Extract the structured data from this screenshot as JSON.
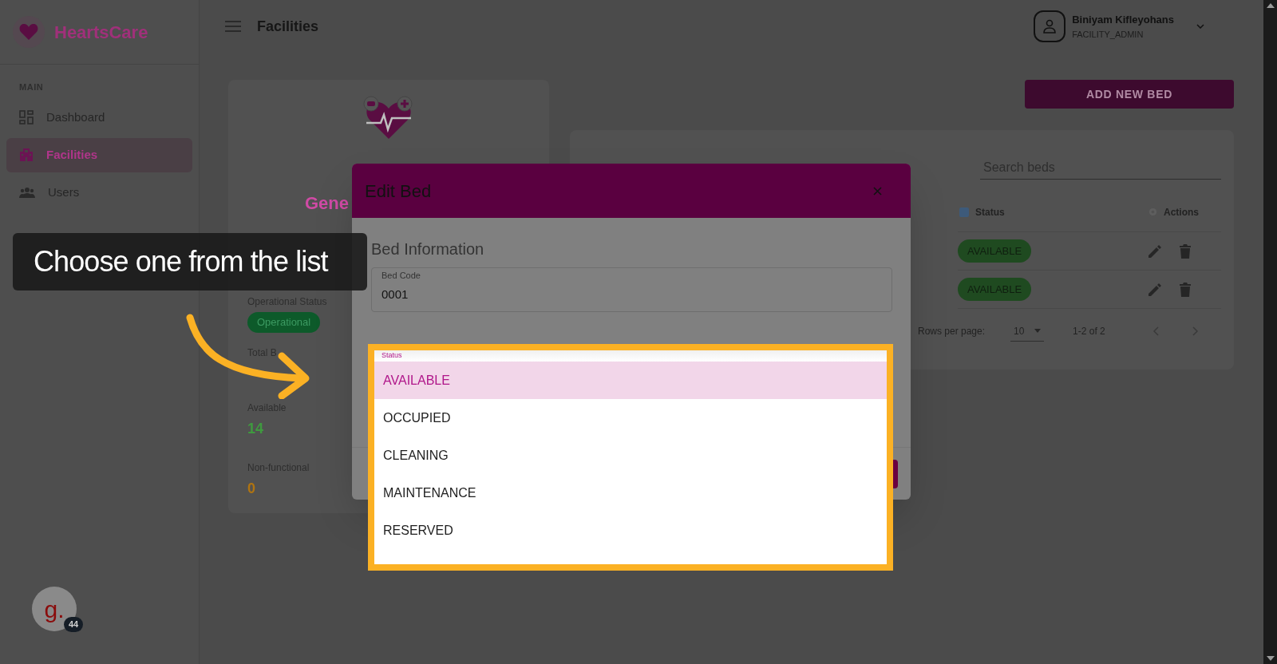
{
  "brand": {
    "name": "HeartsCare"
  },
  "sidebar": {
    "section": "MAIN",
    "items": [
      {
        "label": "Dashboard",
        "kind": "dashboard",
        "selected": false
      },
      {
        "label": "Facilities",
        "kind": "facilities",
        "selected": true
      },
      {
        "label": "Users",
        "kind": "users",
        "selected": false
      }
    ]
  },
  "header": {
    "title": "Facilities",
    "user": {
      "name": "Biniyam Kifleyohans",
      "role": "FACILITY_ADMIN"
    }
  },
  "facility_card": {
    "title": "Gene",
    "operational_status_label": "Operational Status",
    "operational_status": "Operational",
    "stats": [
      {
        "label": "Total B"
      },
      {
        "label": "Available",
        "value": "14",
        "color": "#3f9a3f"
      },
      {
        "label": "Non-functional",
        "value": "0",
        "color": "#b07410"
      }
    ]
  },
  "add_button": "ADD NEW BED",
  "beds_table": {
    "search_placeholder": "Search beds",
    "columns": [
      "Status",
      "Actions"
    ],
    "rows": [
      {
        "status": "AVAILABLE"
      },
      {
        "status": "AVAILABLE"
      }
    ],
    "pagination": {
      "rows_per_page_label": "Rows per page:",
      "rows_per_page": "10",
      "range": "1-2 of 2"
    }
  },
  "modal": {
    "title": "Edit Bed",
    "section": "Bed Information",
    "field": {
      "label": "Bed Code",
      "value": "0001"
    },
    "status_field": {
      "label": "Status",
      "options": [
        {
          "label": "AVAILABLE",
          "selected": true
        },
        {
          "label": "OCCUPIED",
          "selected": false
        },
        {
          "label": "CLEANING",
          "selected": false
        },
        {
          "label": "MAINTENANCE",
          "selected": false
        },
        {
          "label": "RESERVED",
          "selected": false
        }
      ]
    }
  },
  "guide": {
    "callout": "Choose one from the list",
    "badge": "44",
    "logo": "g."
  }
}
